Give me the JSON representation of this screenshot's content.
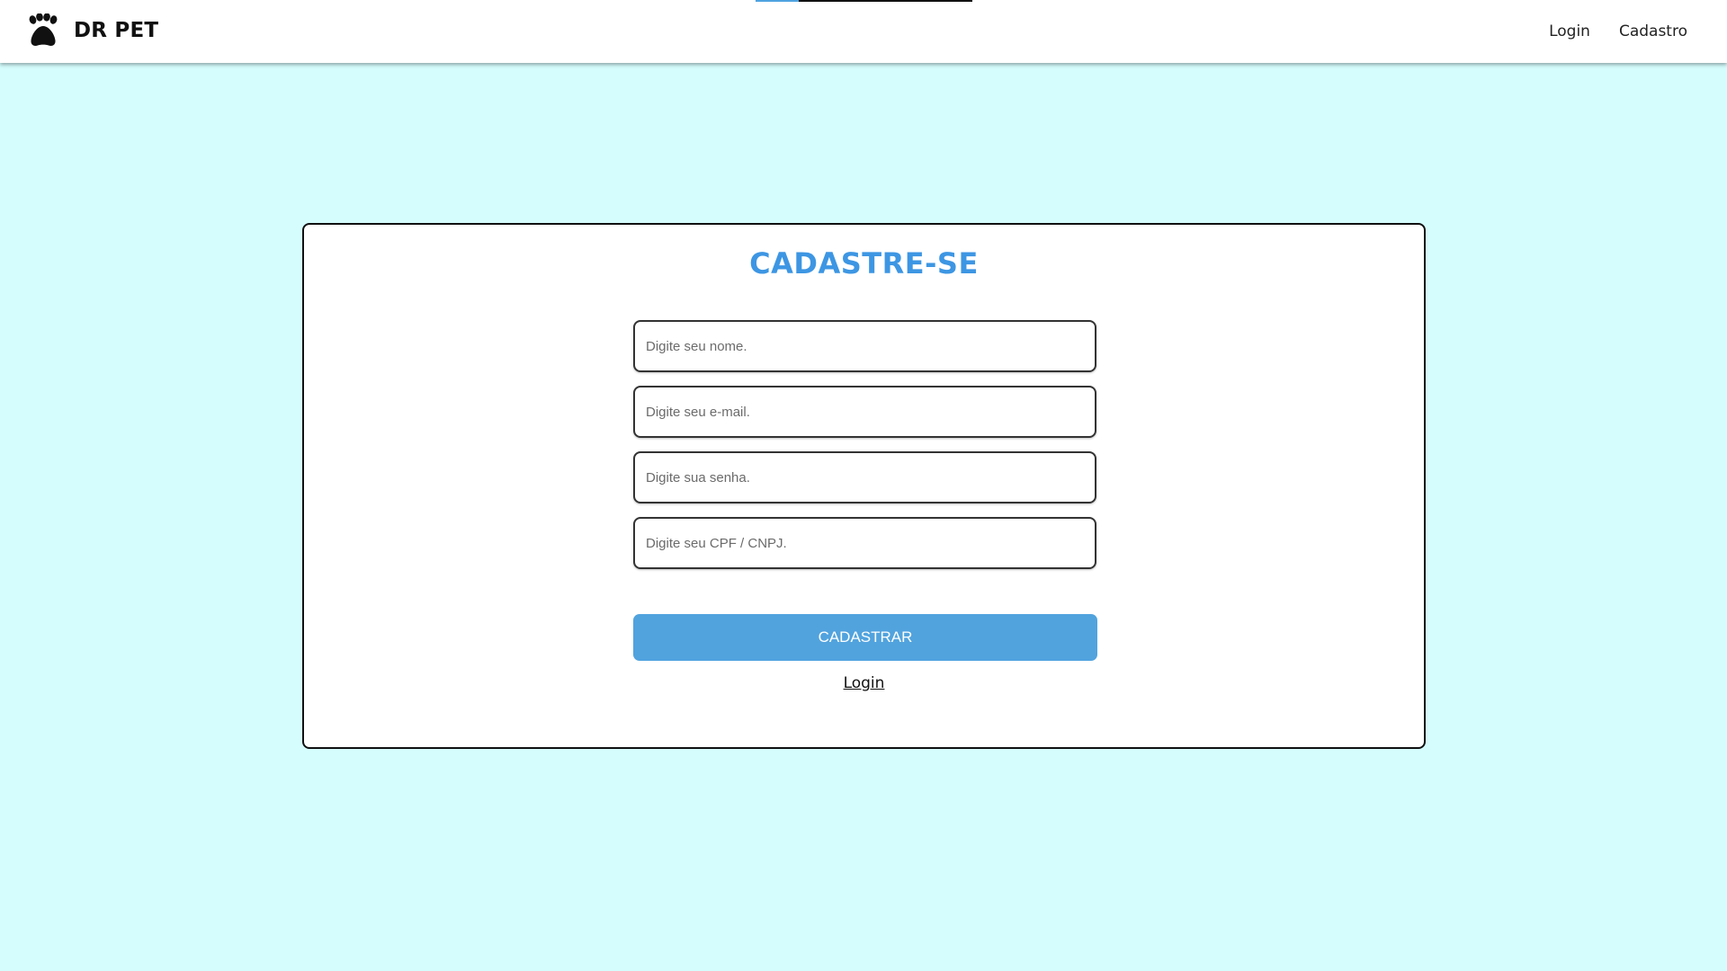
{
  "navbar": {
    "brand_name": "DR PET",
    "brand_icon": "paw-icon",
    "links": [
      {
        "label": "Login"
      },
      {
        "label": "Cadastro"
      }
    ]
  },
  "form": {
    "title": "CADASTRE-SE",
    "fields": {
      "name": {
        "placeholder": "Digite seu nome.",
        "value": ""
      },
      "email": {
        "placeholder": "Digite seu e-mail.",
        "value": ""
      },
      "password": {
        "placeholder": "Digite sua senha.",
        "value": ""
      },
      "document": {
        "placeholder": "Digite seu CPF / CNPJ.",
        "value": ""
      }
    },
    "submit_label": "CADASTRAR",
    "login_link": "Login"
  },
  "colors": {
    "page_background": "#d5fdfe",
    "title": "#3d96e3",
    "button": "#51a3de"
  }
}
